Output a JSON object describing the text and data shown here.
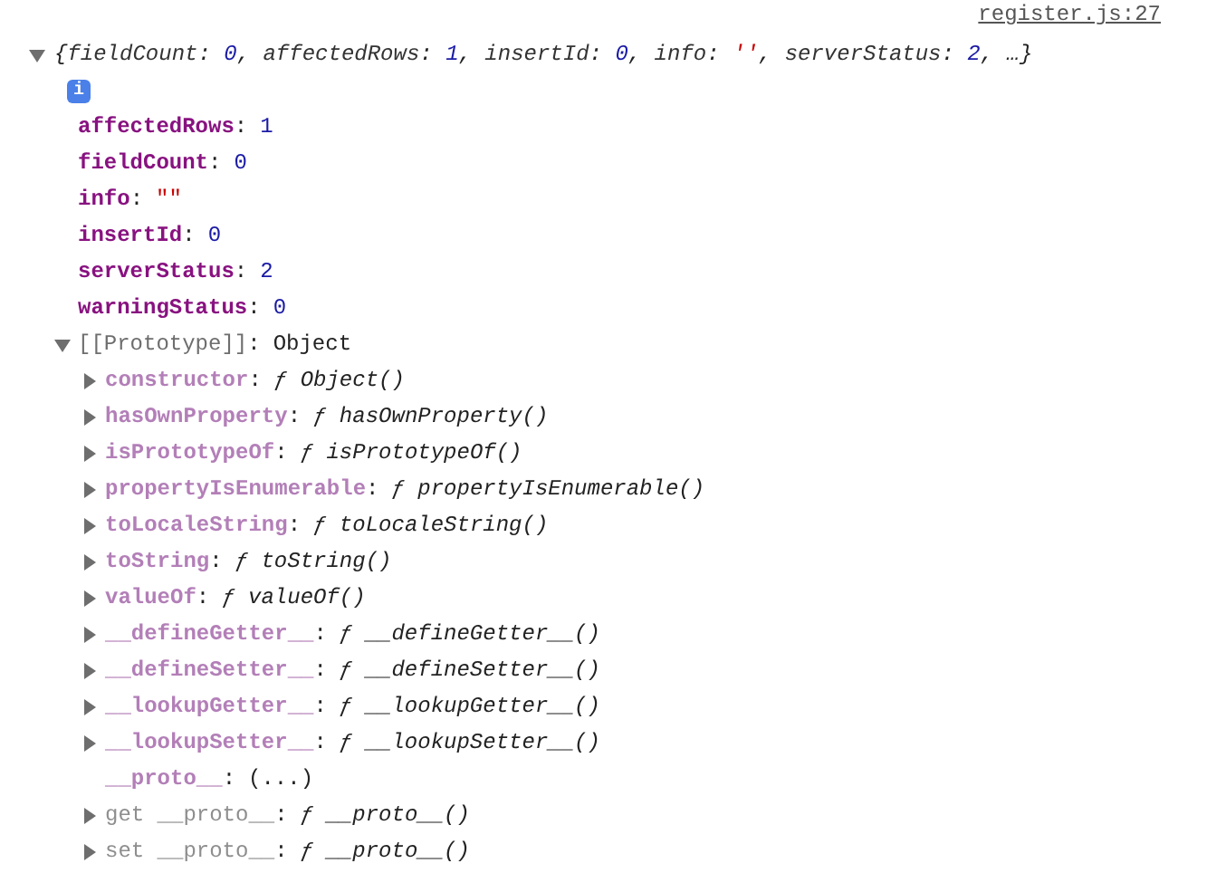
{
  "source_link": "register.js:27",
  "summary": {
    "expanded": true,
    "tokens": [
      {
        "kind": "punct",
        "text": "{"
      },
      {
        "kind": "key",
        "text": "fieldCount"
      },
      {
        "kind": "punct",
        "text": ": "
      },
      {
        "kind": "number",
        "text": "0"
      },
      {
        "kind": "punct",
        "text": ", "
      },
      {
        "kind": "key",
        "text": "affectedRows"
      },
      {
        "kind": "punct",
        "text": ": "
      },
      {
        "kind": "number",
        "text": "1"
      },
      {
        "kind": "punct",
        "text": ", "
      },
      {
        "kind": "key",
        "text": "insertId"
      },
      {
        "kind": "punct",
        "text": ": "
      },
      {
        "kind": "number",
        "text": "0"
      },
      {
        "kind": "punct",
        "text": ", "
      },
      {
        "kind": "key",
        "text": "info"
      },
      {
        "kind": "punct",
        "text": ": "
      },
      {
        "kind": "string",
        "text": "''"
      },
      {
        "kind": "punct",
        "text": ", "
      },
      {
        "kind": "key",
        "text": "serverStatus"
      },
      {
        "kind": "punct",
        "text": ": "
      },
      {
        "kind": "number",
        "text": "2"
      },
      {
        "kind": "punct",
        "text": ", …}"
      }
    ]
  },
  "info_badge": "i",
  "properties": [
    {
      "key": "affectedRows",
      "colon": ":",
      "value": "1",
      "kind": "number"
    },
    {
      "key": "fieldCount",
      "colon": ":",
      "value": "0",
      "kind": "number"
    },
    {
      "key": "info",
      "colon": ":",
      "value": "\"\"",
      "kind": "string"
    },
    {
      "key": "insertId",
      "colon": ":",
      "value": "0",
      "kind": "number"
    },
    {
      "key": "serverStatus",
      "colon": ":",
      "value": "2",
      "kind": "number"
    },
    {
      "key": "warningStatus",
      "colon": ":",
      "value": "0",
      "kind": "number"
    }
  ],
  "prototype": {
    "key": "[[Prototype]]",
    "colon": ":",
    "value": "Object",
    "expanded": true,
    "children": [
      {
        "kind": "method",
        "key": "constructor",
        "colon": ":",
        "value": "ƒ Object()",
        "expanded": false
      },
      {
        "kind": "method",
        "key": "hasOwnProperty",
        "colon": ":",
        "value": "ƒ hasOwnProperty()",
        "expanded": false
      },
      {
        "kind": "method",
        "key": "isPrototypeOf",
        "colon": ":",
        "value": "ƒ isPrototypeOf()",
        "expanded": false
      },
      {
        "kind": "method",
        "key": "propertyIsEnumerable",
        "colon": ":",
        "value": "ƒ propertyIsEnumerable()",
        "expanded": false
      },
      {
        "kind": "method",
        "key": "toLocaleString",
        "colon": ":",
        "value": "ƒ toLocaleString()",
        "expanded": false
      },
      {
        "kind": "method",
        "key": "toString",
        "colon": ":",
        "value": "ƒ toString()",
        "expanded": false
      },
      {
        "kind": "method",
        "key": "valueOf",
        "colon": ":",
        "value": "ƒ valueOf()",
        "expanded": false
      },
      {
        "kind": "method",
        "key": "__defineGetter__",
        "colon": ":",
        "value": "ƒ __defineGetter__()",
        "expanded": false
      },
      {
        "kind": "method",
        "key": "__defineSetter__",
        "colon": ":",
        "value": "ƒ __defineSetter__()",
        "expanded": false
      },
      {
        "kind": "method",
        "key": "__lookupGetter__",
        "colon": ":",
        "value": "ƒ __lookupGetter__()",
        "expanded": false
      },
      {
        "kind": "method",
        "key": "__lookupSetter__",
        "colon": ":",
        "value": "ƒ __lookupSetter__()",
        "expanded": false
      },
      {
        "kind": "lazy",
        "key": "__proto__",
        "colon": ":",
        "value": "(...)"
      },
      {
        "kind": "accessor",
        "key": "get __proto__",
        "colon": ":",
        "value": "ƒ __proto__()",
        "expanded": false
      },
      {
        "kind": "accessor",
        "key": "set __proto__",
        "colon": ":",
        "value": "ƒ __proto__()",
        "expanded": false
      }
    ]
  }
}
